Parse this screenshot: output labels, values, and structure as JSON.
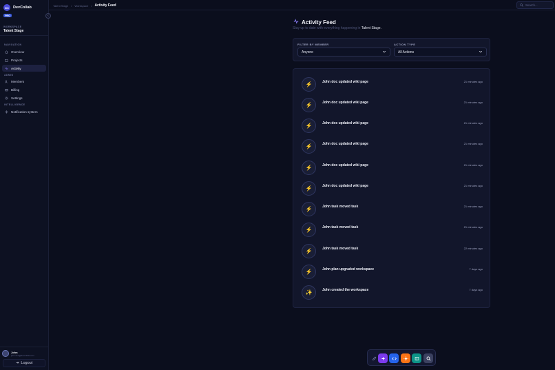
{
  "app": {
    "name": "DevCollab",
    "logo_text": "DC",
    "plan_badge": "PRO"
  },
  "workspace": {
    "label": "WORKSPACE",
    "name": "Talent Stage"
  },
  "nav": {
    "navigation_label": "NAVIGATION",
    "items": [
      {
        "label": "Overview",
        "icon": "home-icon"
      },
      {
        "label": "Projects",
        "icon": "folder-icon"
      },
      {
        "label": "Activity",
        "icon": "activity-icon",
        "active": true
      }
    ],
    "admin_label": "ADMIN",
    "admin_items": [
      {
        "label": "Members",
        "icon": "users-icon"
      },
      {
        "label": "Billing",
        "icon": "card-icon"
      },
      {
        "label": "Settings",
        "icon": "gear-icon"
      }
    ],
    "intelligence_label": "INTELLIGENCE",
    "intelligence_items": [
      {
        "label": "Notification system",
        "icon": "sparkle-icon"
      }
    ]
  },
  "user": {
    "name": "John",
    "email": "john.doe@devcollab.com",
    "logout_label": "Logout"
  },
  "breadcrumb": {
    "items": [
      "Talent Stage",
      "Workspace"
    ],
    "current": "Activity Feed"
  },
  "search": {
    "placeholder": "Search..."
  },
  "header": {
    "title": "Activity Feed",
    "subtitle_prefix": "Stay up to date with everything happening in",
    "subtitle_workspace": "Talent Stage."
  },
  "filters": {
    "member_label": "FILTER BY MEMBER",
    "member_value": "Anyone",
    "action_label": "ACTION TYPE",
    "action_value": "All Actions"
  },
  "feed": [
    {
      "text": "John doc updated wiki page",
      "time": "21 minutes ago",
      "icon": "⚡"
    },
    {
      "text": "John doc updated wiki page",
      "time": "21 minutes ago",
      "icon": "⚡"
    },
    {
      "text": "John doc updated wiki page",
      "time": "21 minutes ago",
      "icon": "⚡"
    },
    {
      "text": "John doc updated wiki page",
      "time": "21 minutes ago",
      "icon": "⚡"
    },
    {
      "text": "John doc updated wiki page",
      "time": "21 minutes ago",
      "icon": "⚡"
    },
    {
      "text": "John doc updated wiki page",
      "time": "21 minutes ago",
      "icon": "⚡"
    },
    {
      "text": "John task moved task",
      "time": "21 minutes ago",
      "icon": "⚡"
    },
    {
      "text": "John task moved task",
      "time": "21 minutes ago",
      "icon": "⚡"
    },
    {
      "text": "John task moved task",
      "time": "22 minutes ago",
      "icon": "⚡"
    },
    {
      "text": "John plan upgraded workspace",
      "time": "7 days ago",
      "icon": "⚡"
    },
    {
      "text": "John created the workspace",
      "time": "7 days ago",
      "icon": "✨"
    }
  ],
  "dock": {
    "items": [
      {
        "name": "pen-icon",
        "color": "#131730"
      },
      {
        "name": "plus-icon",
        "color": "#7c3aed"
      },
      {
        "name": "code-icon",
        "color": "#2563eb"
      },
      {
        "name": "sun-icon",
        "color": "#f97316"
      },
      {
        "name": "book-icon",
        "color": "#0d9488"
      },
      {
        "name": "search-icon",
        "color": "#3b4160"
      }
    ]
  },
  "colors": {
    "background": "#0b0e1d",
    "card": "#12162b",
    "accent": "#4b4ddb",
    "active_nav": "#1d2140"
  }
}
